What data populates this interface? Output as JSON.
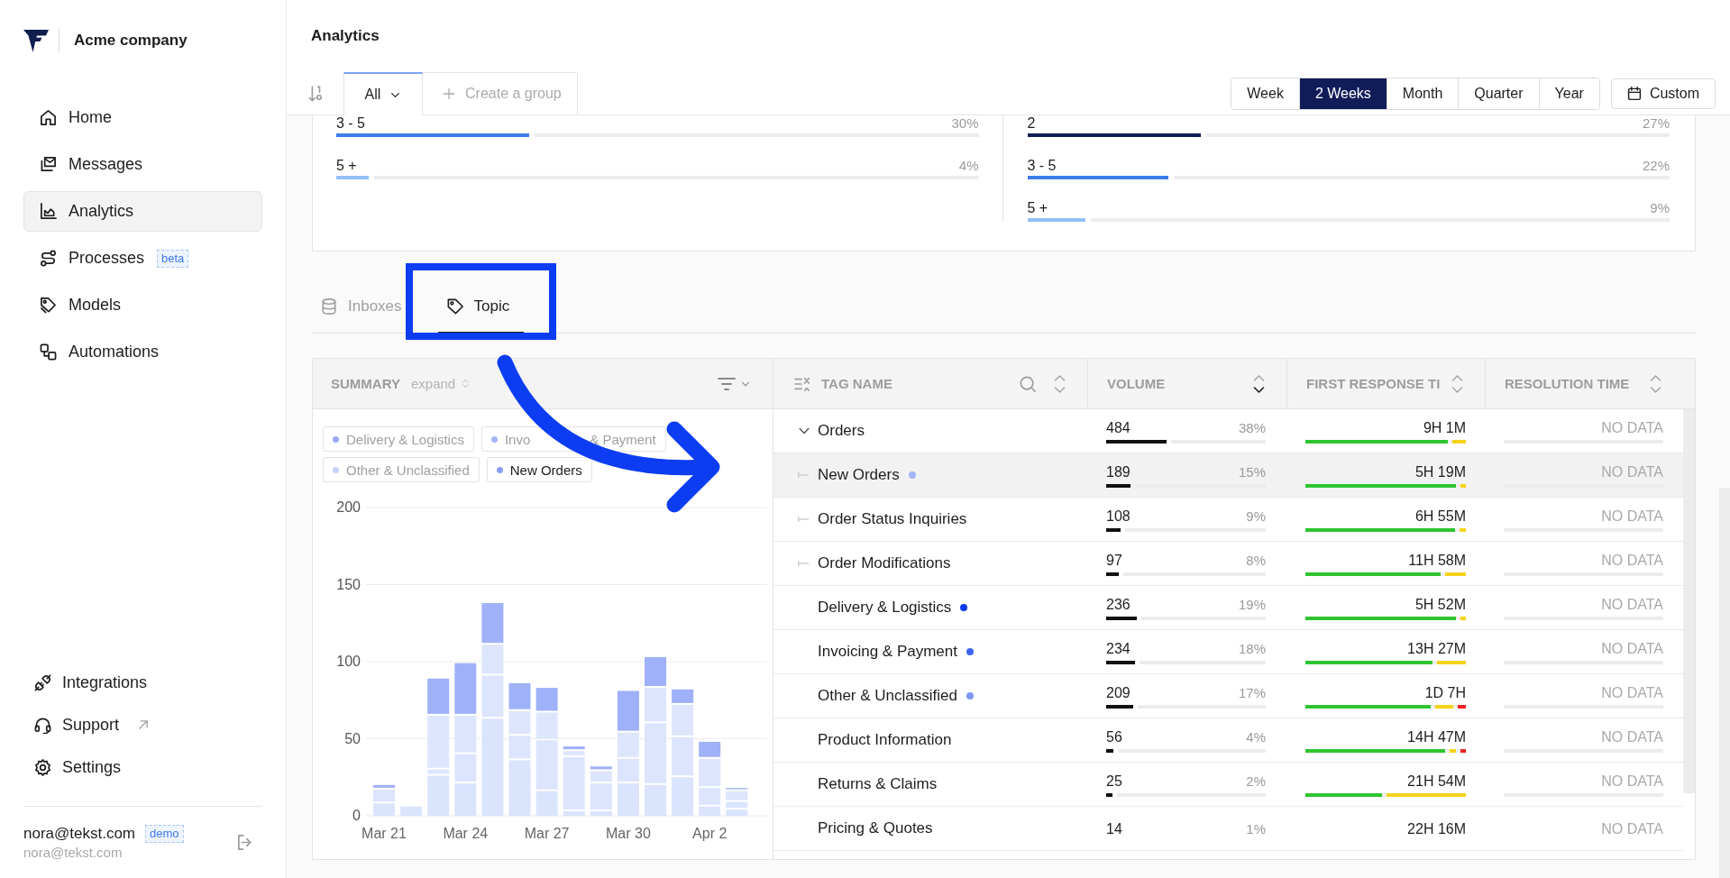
{
  "sidebar": {
    "brand": "Acme company",
    "nav": [
      {
        "label": "Home",
        "selected": false
      },
      {
        "label": "Messages",
        "selected": false
      },
      {
        "label": "Analytics",
        "selected": true
      },
      {
        "label": "Processes",
        "selected": false,
        "badge": "beta"
      },
      {
        "label": "Models",
        "selected": false
      },
      {
        "label": "Automations",
        "selected": false
      }
    ],
    "bottom_nav": [
      {
        "label": "Integrations",
        "selected": false,
        "external": false
      },
      {
        "label": "Support",
        "selected": false,
        "external": true
      },
      {
        "label": "Settings",
        "selected": false,
        "external": false
      }
    ],
    "user": {
      "name": "nora@tekst.com",
      "badge": "demo",
      "email": "nora@tekst.com"
    }
  },
  "page": {
    "title": "Analytics"
  },
  "toolbar": {
    "groups": [
      {
        "label": "All",
        "selected": true
      }
    ],
    "create_group": "Create a group",
    "periods": [
      {
        "label": "Week",
        "selected": false
      },
      {
        "label": "2 Weeks",
        "selected": true
      },
      {
        "label": "Month",
        "selected": false
      },
      {
        "label": "Quarter",
        "selected": false
      },
      {
        "label": "Year",
        "selected": false
      }
    ],
    "custom_range": "Custom"
  },
  "distribution": [
    {
      "bars": [
        {
          "label": "3 - 5",
          "percent": "30%",
          "level": 0.3,
          "color": "#3c7de9"
        },
        {
          "label": "5 +",
          "percent": "4%",
          "level": 0.05,
          "color": "#93c0f7"
        }
      ]
    },
    {
      "bars": [
        {
          "label": "2",
          "percent": "27%",
          "level": 0.27,
          "color": "#101d58"
        },
        {
          "label": "3 - 5",
          "percent": "22%",
          "level": 0.22,
          "color": "#3c7de9"
        },
        {
          "label": "5 +",
          "percent": "9%",
          "level": 0.09,
          "color": "#93c0f7"
        }
      ]
    }
  ],
  "section_tabs": [
    {
      "label": "Inboxes",
      "selected": false
    },
    {
      "label": "Topic",
      "selected": true
    }
  ],
  "summary": {
    "title": "SUMMARY",
    "toggle": "expand",
    "legend": [
      {
        "label": "Delivery & Logistics",
        "color": "#98a9f5",
        "selected": false
      },
      {
        "label": "Invo",
        "label_after_arrow": "& Payment",
        "color": "#a5b4f7",
        "selected": false
      },
      {
        "label": "Other & Unclassified",
        "color": "#c6d0fa",
        "selected": false
      },
      {
        "label": "New Orders",
        "color": "#8a9ff5",
        "selected": true
      }
    ],
    "chart_data": {
      "type": "bar",
      "stacked": true,
      "grid": true,
      "categories": [
        "Mar 21",
        null,
        null,
        "Mar 24",
        null,
        null,
        "Mar 27",
        null,
        null,
        "Mar 30",
        null,
        null,
        "Apr 2",
        null
      ],
      "ylim": [
        0,
        200
      ],
      "yticks": [
        0,
        50,
        100,
        150,
        200
      ],
      "series": [
        {
          "color": "#dbe4fd",
          "values": [
            8,
            6,
            26,
            21,
            63,
            36,
            16,
            3,
            3,
            21,
            20,
            25,
            6,
            4
          ]
        },
        {
          "color": "#dce5fd",
          "values": [
            9,
            0,
            4,
            19,
            28,
            16,
            33,
            35,
            18,
            16,
            40,
            26,
            12,
            5
          ]
        },
        {
          "color": "#dde6fd",
          "values": [
            0,
            0,
            35,
            25,
            20,
            16,
            18,
            4,
            8,
            17,
            23,
            21,
            19,
            7
          ]
        },
        {
          "color": "#9fb1f8",
          "values": [
            3,
            0,
            24,
            34,
            27,
            18,
            16,
            3,
            3,
            27,
            20,
            10,
            11,
            2
          ]
        }
      ]
    }
  },
  "table": {
    "columns": [
      {
        "label": "TAG NAME",
        "sorted": false
      },
      {
        "label": "VOLUME",
        "sorted": true
      },
      {
        "label": "FIRST RESPONSE TI",
        "sorted": false
      },
      {
        "label": "RESOLUTION TIME",
        "sorted": false
      }
    ],
    "rows": [
      {
        "name": "Orders",
        "selected": false,
        "expanded": true,
        "volume": "484",
        "share": "38%",
        "volume_bar": {
          "level": 0.38
        },
        "response": "9H 1M",
        "response_bar": {
          "level": 0.89,
          "color": "#2ec52e",
          "rest": {
            "color": "#f6d31b"
          }
        },
        "resolution": "NO DATA",
        "children": [
          {
            "name": "New Orders",
            "selected": true,
            "color": "#a3b4f8",
            "volume": "189",
            "share": "15%",
            "volume_bar": {
              "level": 0.15
            },
            "response": "5H 19M",
            "response_bar": {
              "level": 0.94,
              "color": "#2ec52e",
              "rest": {
                "color": "#f6d31b"
              }
            },
            "resolution": "NO DATA"
          },
          {
            "name": "Order Status Inquiries",
            "selected": false,
            "volume": "108",
            "share": "9%",
            "volume_bar": {
              "level": 0.09
            },
            "response": "6H 55M",
            "response_bar": {
              "level": 0.93,
              "color": "#2ec52e",
              "rest": {
                "color": "#f6d31b"
              }
            },
            "resolution": "NO DATA"
          },
          {
            "name": "Order Modifications",
            "selected": false,
            "volume": "97",
            "share": "8%",
            "volume_bar": {
              "level": 0.08
            },
            "response": "11H 58M",
            "response_bar": {
              "level": 0.84,
              "color": "#2ec52e",
              "rest": {
                "color": "#f6d31b"
              }
            },
            "resolution": "NO DATA"
          }
        ]
      },
      {
        "name": "Delivery & Logistics",
        "selected": false,
        "color": "#0b3cf0",
        "volume": "236",
        "share": "19%",
        "volume_bar": {
          "level": 0.19
        },
        "response": "5H 52M",
        "response_bar": {
          "level": 0.94,
          "color": "#2ec52e",
          "rest": {
            "color": "#f6d31b"
          }
        },
        "resolution": "NO DATA"
      },
      {
        "name": "Invoicing & Payment",
        "selected": false,
        "color": "#3d66f0",
        "volume": "234",
        "share": "18%",
        "volume_bar": {
          "level": 0.18
        },
        "response": "13H 27M",
        "response_bar": {
          "level": 0.79,
          "color": "#2ec52e",
          "rest": {
            "color": "#f6d31b"
          }
        },
        "resolution": "NO DATA"
      },
      {
        "name": "Other & Unclassified",
        "selected": false,
        "color": "#8196f5",
        "volume": "209",
        "share": "17%",
        "volume_bar": {
          "level": 0.17
        },
        "response": "1D 7H",
        "response_bar": {
          "level": 0.78,
          "color": "#2ec52e",
          "rest": {
            "level": 0.58,
            "color": "#f6d31b",
            "rest": {
              "color": "#ee2121"
            }
          }
        },
        "resolution": "NO DATA"
      },
      {
        "name": "Product Information",
        "selected": false,
        "volume": "56",
        "share": "4%",
        "volume_bar": {
          "level": 0.045
        },
        "response": "14H 47M",
        "response_bar": {
          "level": 0.87,
          "color": "#2ec52e",
          "rest": {
            "level": 0.42,
            "color": "#f6d31b",
            "rest": {
              "color": "#ee2121"
            }
          }
        },
        "resolution": "NO DATA"
      },
      {
        "name": "Returns & Claims",
        "selected": false,
        "volume": "25",
        "share": "2%",
        "volume_bar": {
          "level": 0.04
        },
        "response": "21H 54M",
        "response_bar": {
          "level": 0.48,
          "color": "#2ec52e",
          "rest": {
            "color": "#f6d31b"
          }
        },
        "resolution": "NO DATA"
      },
      {
        "name": "Pricing & Quotes",
        "selected": false,
        "volume": "14",
        "share": "1%",
        "response": "22H 16M",
        "resolution": "NO DATA"
      }
    ]
  }
}
